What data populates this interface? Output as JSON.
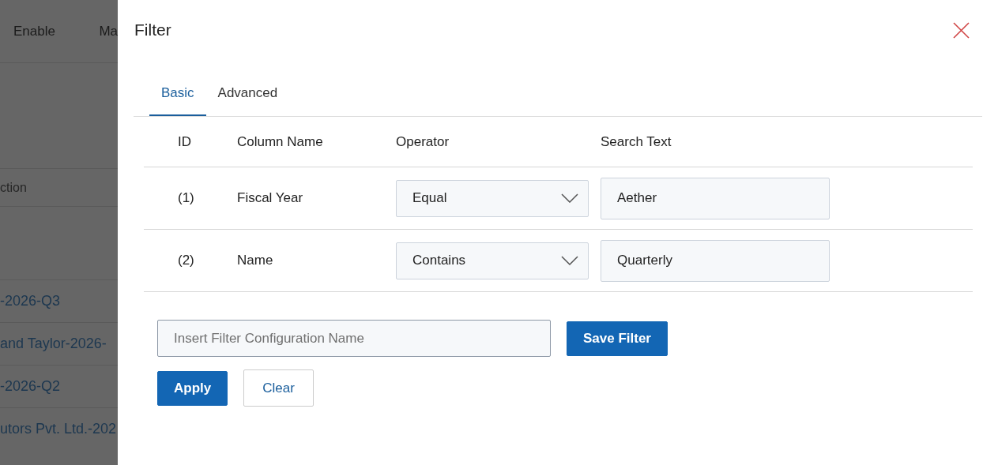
{
  "background": {
    "columns": [
      "Enable",
      "Ma"
    ],
    "subheader": "ction",
    "rows": [
      "-2026-Q3",
      "and Taylor-2026-",
      "-2026-Q2",
      "utors Pvt. Ltd.-202"
    ]
  },
  "dialog": {
    "title": "Filter",
    "tabs": [
      {
        "label": "Basic",
        "selected": true
      },
      {
        "label": "Advanced",
        "selected": false
      }
    ],
    "table": {
      "columns": [
        "ID",
        "Column Name",
        "Operator",
        "Search Text"
      ],
      "rows": [
        {
          "id": "(1)",
          "column": "Fiscal Year",
          "operator": "Equal",
          "search_text": "Aether"
        },
        {
          "id": "(2)",
          "column": "Name",
          "operator": "Contains",
          "search_text": "Quarterly"
        }
      ]
    },
    "config_name": {
      "placeholder": "Insert Filter Configuration Name"
    },
    "save_button": "Save Filter",
    "actions": [
      {
        "label": "Apply",
        "kind": "primary"
      },
      {
        "label": "Clear",
        "kind": "secondary"
      }
    ]
  }
}
